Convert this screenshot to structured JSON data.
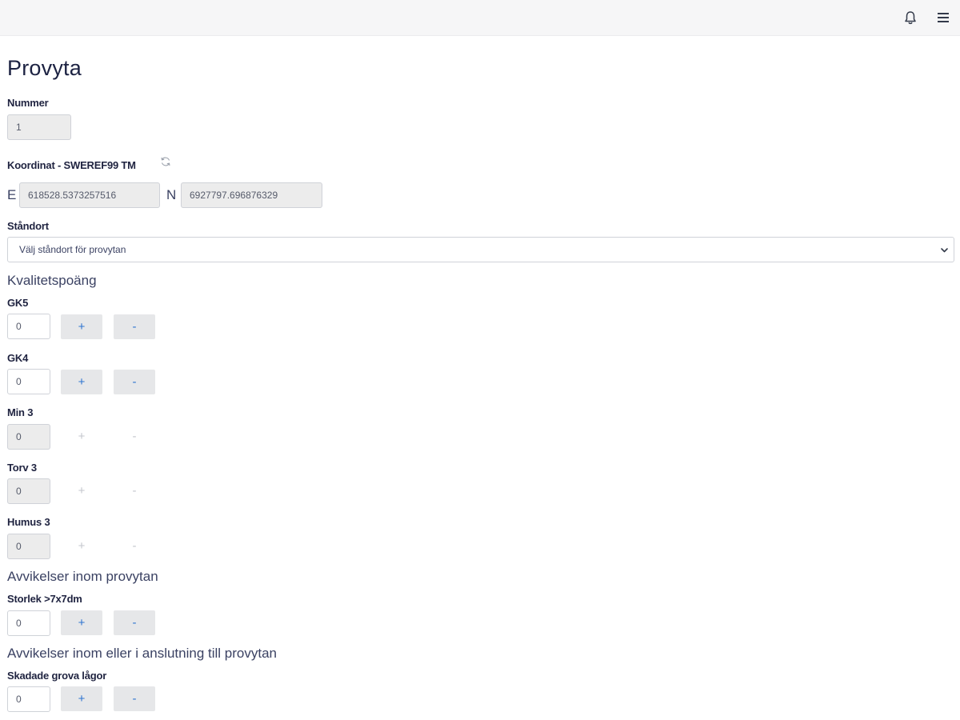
{
  "header": {
    "icons": [
      "bell-icon",
      "hamburger-menu-icon"
    ]
  },
  "page": {
    "title": "Provyta"
  },
  "nummer": {
    "label": "Nummer",
    "value": "1"
  },
  "coordinate": {
    "label": "Koordinat - SWEREF99 TM",
    "refresh_icon": "refresh-icon",
    "e_prefix": "E",
    "e_value": "618528.5373257516",
    "n_prefix": "N",
    "n_value": "6927797.696876329"
  },
  "standort": {
    "label": "Ståndort",
    "placeholder": "Välj ståndort för provytan",
    "chevron_icon": "chevron-down-icon"
  },
  "sections": {
    "kvalitet": "Kvalitetspoäng",
    "avvikelser": "Avvikelser inom provytan",
    "avvikelser_anslutning": "Avvikelser inom eller i anslutning till provytan"
  },
  "steppers": {
    "plus": "+",
    "minus": "-",
    "gk5": {
      "label": "GK5",
      "value": "0",
      "enabled": true
    },
    "gk4": {
      "label": "GK4",
      "value": "0",
      "enabled": true
    },
    "min3": {
      "label": "Min 3",
      "value": "0",
      "enabled": false
    },
    "torv3": {
      "label": "Torv 3",
      "value": "0",
      "enabled": false
    },
    "humus3": {
      "label": "Humus 3",
      "value": "0",
      "enabled": false
    },
    "storlek": {
      "label": "Storlek >7x7dm",
      "value": "0",
      "enabled": true
    },
    "skadade": {
      "label": "Skadade grova lågor",
      "value": "0",
      "enabled": true
    }
  },
  "colors": {
    "accent": "#2e74d0",
    "topbar": "#f6f6f7",
    "readonly_field": "#ececec",
    "disabled_text": "#c3c6cc"
  }
}
